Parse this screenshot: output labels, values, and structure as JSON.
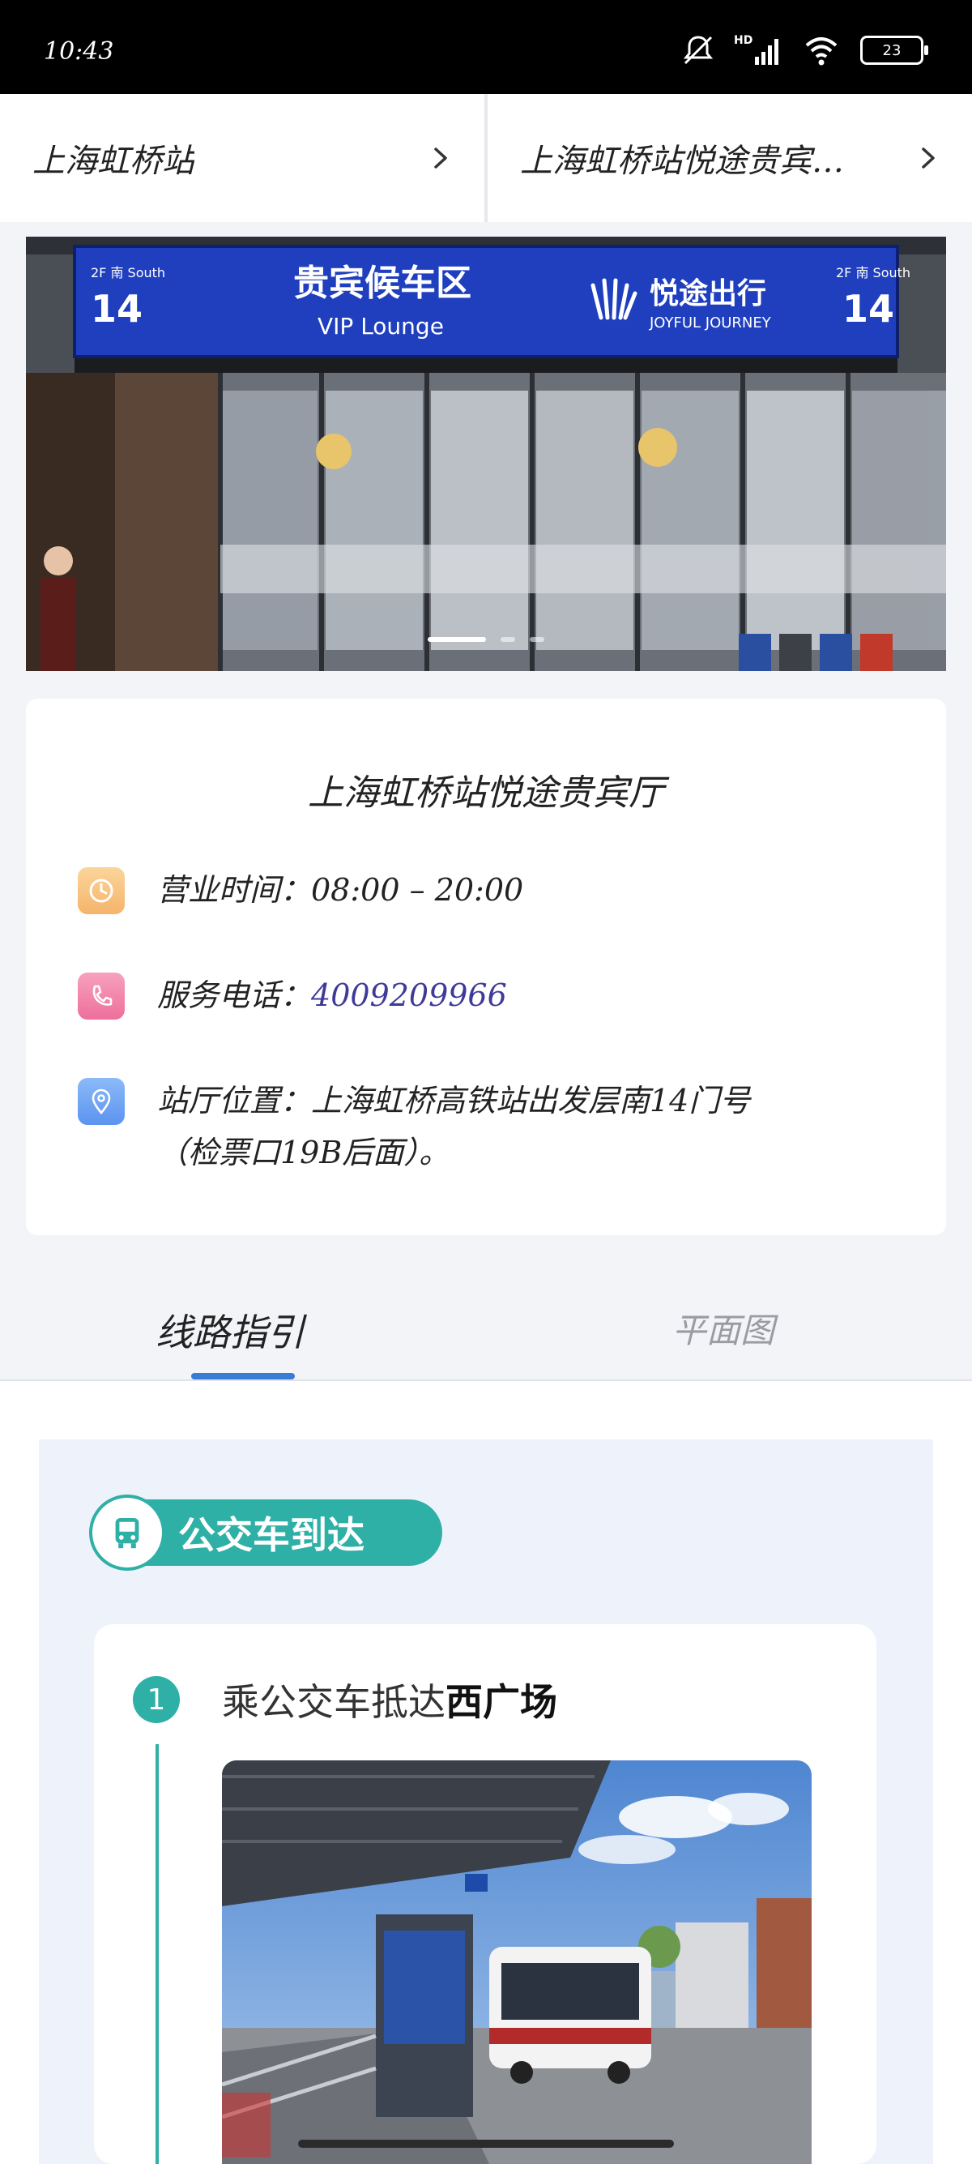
{
  "status_bar": {
    "time": "10:43",
    "battery": "23",
    "icons": [
      "mute-icon",
      "hd-signal-icon",
      "wifi-icon",
      "battery-icon"
    ]
  },
  "top_tabs": [
    {
      "label": "上海虹桥站"
    },
    {
      "label": "上海虹桥站悦途贵宾…"
    }
  ],
  "hero": {
    "sign_main_cn": "贵宾候车区",
    "sign_main_en": "VIP Lounge",
    "sign_brand_cn": "悦途出行",
    "sign_brand_en": "JOYFUL JOURNEY",
    "sign_floor": "2F 南 South",
    "sign_number": "14",
    "carousel_active": 1,
    "carousel_count": 3
  },
  "info": {
    "title": "上海虹桥站悦途贵宾厅",
    "hours": "营业时间：08:00 – 20:00",
    "phone_label": "服务电话：",
    "phone": "4009209966",
    "location_line1": "站厅位置：上海虹桥高铁站出发层南14门号",
    "location_line2": "（检票口19B后面）。"
  },
  "section_tabs": [
    {
      "label": "线路指引",
      "active": true
    },
    {
      "label": "平面图",
      "active": false
    }
  ],
  "guide": {
    "pill_label": "公交车到达",
    "step_number": "1",
    "step_text_prefix": "乘公交车抵达",
    "step_text_bold": "西广场"
  },
  "colors": {
    "accent_blue": "#3a7bd5",
    "teal": "#2fb0a7",
    "phone_link": "#3f3a9a",
    "clock_badge": "#f7c07a",
    "phone_badge": "#f27fa6",
    "location_badge": "#6fa6f4"
  }
}
